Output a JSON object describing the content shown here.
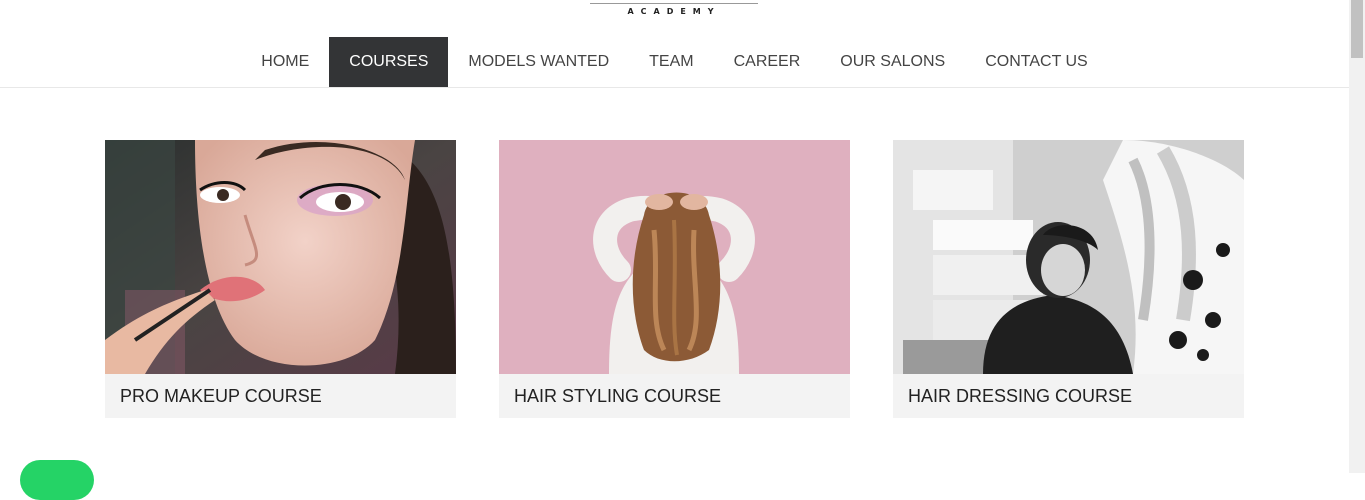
{
  "logo": {
    "subtitle": "ACADEMY"
  },
  "nav": {
    "items": [
      {
        "label": "HOME",
        "active": false
      },
      {
        "label": "COURSES",
        "active": true
      },
      {
        "label": "MODELS WANTED",
        "active": false
      },
      {
        "label": "TEAM",
        "active": false
      },
      {
        "label": "CAREER",
        "active": false
      },
      {
        "label": "OUR SALONS",
        "active": false
      },
      {
        "label": "CONTACT US",
        "active": false
      }
    ]
  },
  "courses": [
    {
      "title": "PRO MAKEUP COURSE",
      "image": "makeup-photo"
    },
    {
      "title": "HAIR STYLING COURSE",
      "image": "hair-styling-photo"
    },
    {
      "title": "HAIR DRESSING COURSE",
      "image": "hair-dressing-photo"
    }
  ],
  "colors": {
    "nav_active_bg": "#333436",
    "card_bg": "#f3f3f3",
    "chat_green": "#25d366"
  }
}
